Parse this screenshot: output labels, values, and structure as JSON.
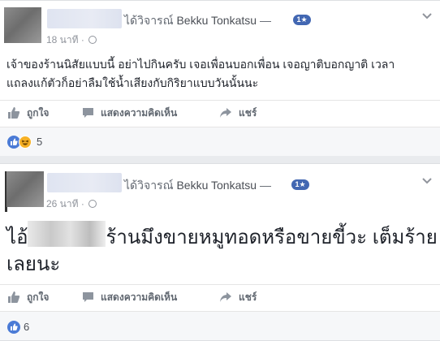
{
  "posts": [
    {
      "header_verb": "ได้วิจารณ์",
      "page_name": "Bekku Tonkatsu",
      "separator": "—",
      "rating_badge": "1★",
      "time": "18 นาที ·",
      "body_line1": "เจ้าของร้านนิสัยแบบนี้ อย่าไปกินครับ เจอเพื่อนบอกเพื่อน เจอญาติบอกญาติ เวลา",
      "body_line2": "แถลงแก้ตัวก็อย่าลืมใช้น้ำเสียงกับกิริยาแบบวันนั้นนะ",
      "actions": {
        "like": "ถูกใจ",
        "comment": "แสดงความคิดเห็น",
        "share": "แชร์"
      },
      "reaction_count": "5"
    },
    {
      "header_verb": "ได้วิจารณ์",
      "page_name": "Bekku Tonkatsu",
      "separator": "—",
      "rating_badge": "1★",
      "time": "26 นาที ·",
      "body_prefix": "ไอ้",
      "body_line1_rest": "ร้านมึงขายหมูทอดหรือขายขี้วะ เต็มร้าย",
      "body_line2": "เลยนะ",
      "actions": {
        "like": "ถูกใจ",
        "comment": "แสดงความคิดเห็น",
        "share": "แชร์"
      },
      "reaction_count": "6"
    }
  ],
  "colors": {
    "link_blue": "#4267b2",
    "like_blue": "#4b7bd6",
    "haha_yellow": "#f7b125",
    "meta_gray": "#90949c"
  },
  "icons": [
    "globe-icon",
    "chevron-down-icon",
    "like-icon",
    "comment-icon",
    "share-icon",
    "like-reaction-icon",
    "haha-reaction-icon"
  ]
}
